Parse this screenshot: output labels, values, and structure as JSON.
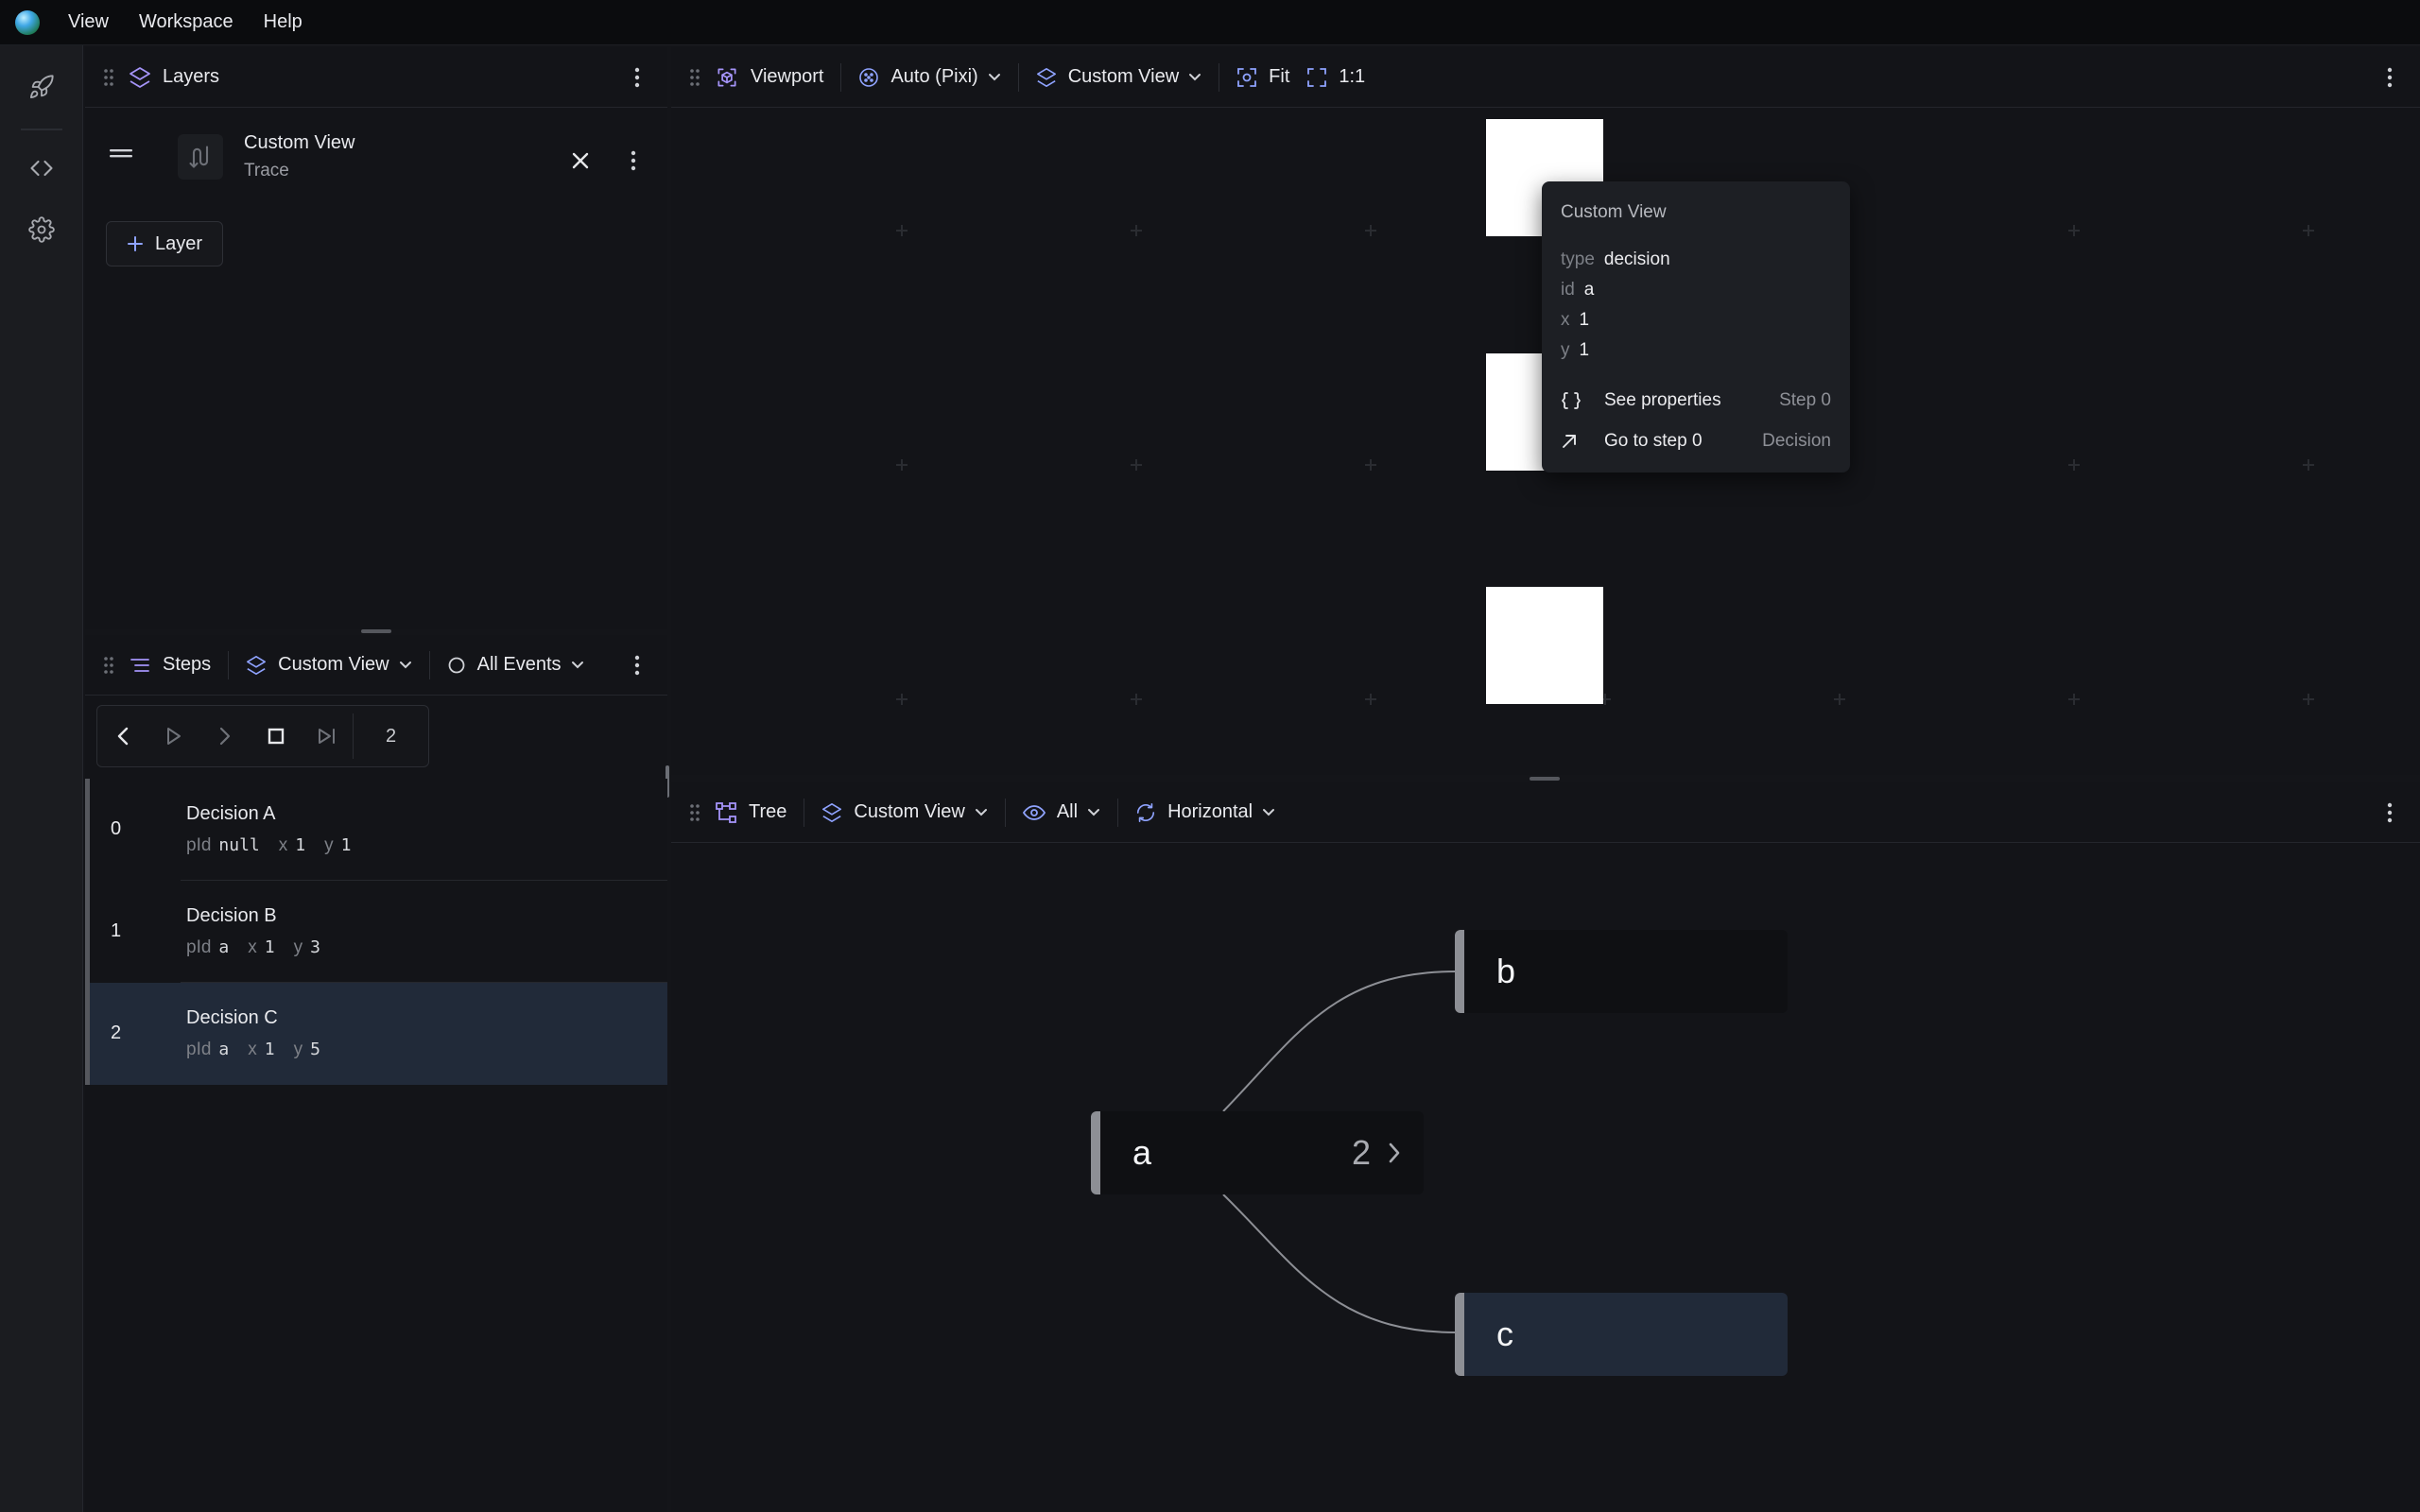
{
  "menubar": {
    "items": [
      "View",
      "Workspace",
      "Help"
    ]
  },
  "rail": {
    "items": [
      "rocket-icon",
      "code-icon",
      "settings-icon"
    ]
  },
  "layers_panel": {
    "title": "Layers",
    "layer": {
      "name": "Custom View",
      "type": "Trace"
    },
    "add_label": "Layer"
  },
  "steps_panel": {
    "title": "Steps",
    "view_select": "Custom View",
    "events_select": "All Events",
    "current_step": "2",
    "steps": [
      {
        "index": "0",
        "name": "Decision A",
        "pid_label": "pId",
        "pid": "null",
        "x_label": "x",
        "x": "1",
        "y_label": "y",
        "y": "1"
      },
      {
        "index": "1",
        "name": "Decision B",
        "pid_label": "pId",
        "pid": "a",
        "x_label": "x",
        "x": "1",
        "y_label": "y",
        "y": "3"
      },
      {
        "index": "2",
        "name": "Decision C",
        "pid_label": "pId",
        "pid": "a",
        "x_label": "x",
        "x": "1",
        "y_label": "y",
        "y": "5"
      }
    ],
    "selected_index": 2
  },
  "viewport_panel": {
    "title": "Viewport",
    "renderer_select": "Auto (Pixi)",
    "view_select": "Custom View",
    "fit_label": "Fit",
    "ratio_label": "1:1",
    "tooltip": {
      "title": "Custom View",
      "rows": [
        {
          "key": "type",
          "value": "decision"
        },
        {
          "key": "id",
          "value": "a"
        },
        {
          "key": "x",
          "value": "1"
        },
        {
          "key": "y",
          "value": "1"
        }
      ],
      "actions": [
        {
          "label": "See properties",
          "right": "Step 0",
          "icon": "braces-icon"
        },
        {
          "label": "Go to step 0",
          "right": "Decision",
          "icon": "arrow-up-right-icon"
        }
      ]
    }
  },
  "tree_panel": {
    "title": "Tree",
    "view_select": "Custom View",
    "filter_select": "All",
    "orientation_select": "Horizontal",
    "nodes": [
      {
        "label": "a",
        "count": "2"
      },
      {
        "label": "b"
      },
      {
        "label": "c"
      }
    ]
  },
  "colors": {
    "accent": "#8b7cf6",
    "selected_row": "#212a39",
    "background": "#131418"
  }
}
